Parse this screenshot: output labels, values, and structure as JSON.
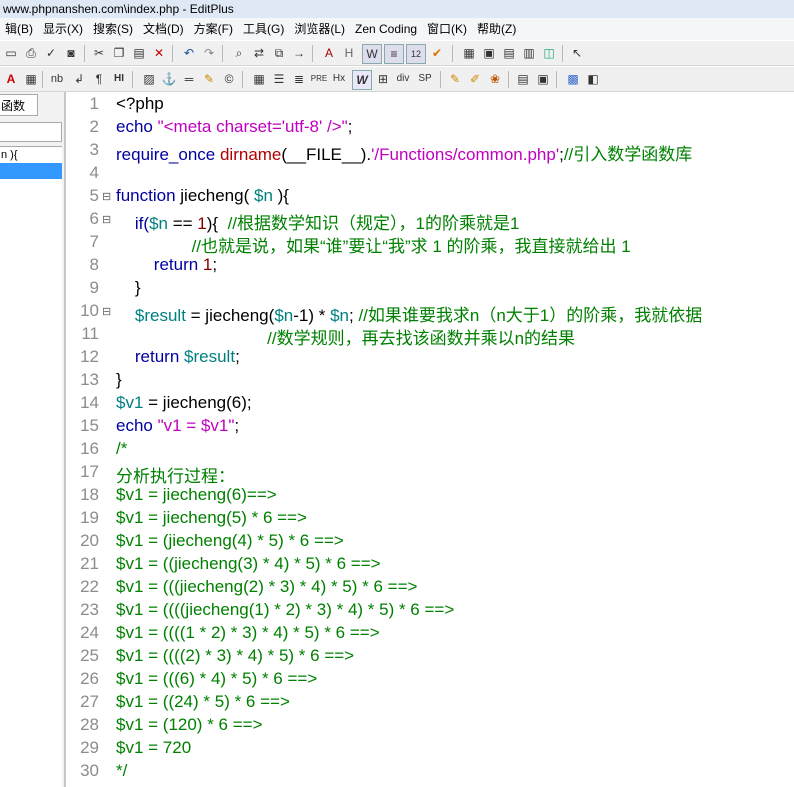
{
  "window": {
    "title": "www.phpnanshen.com\\index.php - EditPlus"
  },
  "menu": [
    "辑(B)",
    "显示(X)",
    "搜索(S)",
    "文档(D)",
    "方案(F)",
    "工具(G)",
    "浏览器(L)",
    "Zen Coding",
    "窗口(K)",
    "帮助(Z)"
  ],
  "toolbar2_labels": {
    "a": "A",
    "nb": "nb",
    "hi": "HI",
    "hx": "Hx",
    "pre": "PRE",
    "w": "W",
    "div": "div",
    "sp": "SP"
  },
  "sidebar": {
    "tab_label": "函数",
    "items": [
      "n ){"
    ]
  },
  "editor": {
    "lines": [
      {
        "n": "1",
        "fold": "",
        "segments": [
          {
            "t": "<?php",
            "c": "#000000"
          }
        ]
      },
      {
        "n": "2",
        "fold": "",
        "segments": [
          {
            "t": "echo ",
            "c": "#0000a0"
          },
          {
            "t": "\"<meta charset='utf-8' />\"",
            "c": "#c000c0"
          },
          {
            "t": ";",
            "c": "#000000"
          }
        ]
      },
      {
        "n": "3",
        "fold": "",
        "segments": [
          {
            "t": "require_once ",
            "c": "#0000a0"
          },
          {
            "t": "dirname",
            "c": "#b00000"
          },
          {
            "t": "(__FILE__).",
            "c": "#000000"
          },
          {
            "t": "'/Functions/common.php'",
            "c": "#c000c0"
          },
          {
            "t": ";",
            "c": "#000000"
          },
          {
            "t": "//引入数学函数库",
            "c": "#008000"
          }
        ]
      },
      {
        "n": "4",
        "fold": "",
        "segments": []
      },
      {
        "n": "5",
        "fold": "⊟",
        "segments": [
          {
            "t": "function ",
            "c": "#0000a0"
          },
          {
            "t": "jiecheng( ",
            "c": "#000000"
          },
          {
            "t": "$n",
            "c": "#008080"
          },
          {
            "t": " ){",
            "c": "#000000"
          }
        ]
      },
      {
        "n": "6",
        "fold": "⊟",
        "segments": [
          {
            "t": "    if(",
            "c": "#0000a0"
          },
          {
            "t": "$n",
            "c": "#008080"
          },
          {
            "t": " == ",
            "c": "#000000"
          },
          {
            "t": "1",
            "c": "#800000"
          },
          {
            "t": "){  ",
            "c": "#000000"
          },
          {
            "t": "//根据数学知识（规定），1的阶乘就是1",
            "c": "#008000"
          }
        ]
      },
      {
        "n": "7",
        "fold": "",
        "segments": [
          {
            "t": "                //也就是说，如果“谁”要让“我”求 1 的阶乘，我直接就给出 1",
            "c": "#008000"
          }
        ]
      },
      {
        "n": "8",
        "fold": "",
        "segments": [
          {
            "t": "        return ",
            "c": "#0000a0"
          },
          {
            "t": "1",
            "c": "#800000"
          },
          {
            "t": ";",
            "c": "#000000"
          }
        ]
      },
      {
        "n": "9",
        "fold": "",
        "segments": [
          {
            "t": "    }",
            "c": "#000000"
          }
        ]
      },
      {
        "n": "10",
        "fold": "⊟",
        "segments": [
          {
            "t": "    ",
            "c": "#000000"
          },
          {
            "t": "$result",
            "c": "#008080"
          },
          {
            "t": " = jiecheng(",
            "c": "#000000"
          },
          {
            "t": "$n",
            "c": "#008080"
          },
          {
            "t": "-1) * ",
            "c": "#000000"
          },
          {
            "t": "$n",
            "c": "#008080"
          },
          {
            "t": "; ",
            "c": "#000000"
          },
          {
            "t": "//如果谁要我求n（n大于1）的阶乘，我就依据",
            "c": "#008000"
          }
        ]
      },
      {
        "n": "11",
        "fold": "",
        "segments": [
          {
            "t": "                                //数学规则，再去找该函数并乘以n的结果",
            "c": "#008000"
          }
        ]
      },
      {
        "n": "12",
        "fold": "",
        "segments": [
          {
            "t": "    return ",
            "c": "#0000a0"
          },
          {
            "t": "$result",
            "c": "#008080"
          },
          {
            "t": ";",
            "c": "#000000"
          }
        ]
      },
      {
        "n": "13",
        "fold": "",
        "segments": [
          {
            "t": "}",
            "c": "#000000"
          }
        ]
      },
      {
        "n": "14",
        "fold": "",
        "segments": [
          {
            "t": "$v1",
            "c": "#008080"
          },
          {
            "t": " = jiecheng(6);",
            "c": "#000000"
          }
        ]
      },
      {
        "n": "15",
        "fold": "",
        "segments": [
          {
            "t": "echo ",
            "c": "#0000a0"
          },
          {
            "t": "\"v1 = $v1\"",
            "c": "#c000c0"
          },
          {
            "t": ";",
            "c": "#000000"
          }
        ]
      },
      {
        "n": "16",
        "fold": "",
        "segments": [
          {
            "t": "/*",
            "c": "#008000"
          }
        ]
      },
      {
        "n": "17",
        "fold": "",
        "segments": [
          {
            "t": "分析执行过程：",
            "c": "#008000"
          }
        ]
      },
      {
        "n": "18",
        "fold": "",
        "segments": [
          {
            "t": "$v1 = jiecheng(6)==>",
            "c": "#008000"
          }
        ]
      },
      {
        "n": "19",
        "fold": "",
        "segments": [
          {
            "t": "$v1 = jiecheng(5) * 6 ==>",
            "c": "#008000"
          }
        ]
      },
      {
        "n": "20",
        "fold": "",
        "segments": [
          {
            "t": "$v1 = (jiecheng(4) * 5) * 6 ==>",
            "c": "#008000"
          }
        ]
      },
      {
        "n": "21",
        "fold": "",
        "segments": [
          {
            "t": "$v1 = ((jiecheng(3) * 4) * 5) * 6 ==>",
            "c": "#008000"
          }
        ]
      },
      {
        "n": "22",
        "fold": "",
        "segments": [
          {
            "t": "$v1 = (((jiecheng(2) * 3) * 4) * 5) * 6 ==>",
            "c": "#008000"
          }
        ]
      },
      {
        "n": "23",
        "fold": "",
        "segments": [
          {
            "t": "$v1 = ((((jiecheng(1) * 2) * 3) * 4) * 5) * 6 ==>",
            "c": "#008000"
          }
        ]
      },
      {
        "n": "24",
        "fold": "",
        "segments": [
          {
            "t": "$v1 = ((((1 * 2) * 3) * 4) * 5) * 6 ==>",
            "c": "#008000"
          }
        ]
      },
      {
        "n": "25",
        "fold": "",
        "segments": [
          {
            "t": "$v1 = ((((2) * 3) * 4) * 5) * 6 ==>",
            "c": "#008000"
          }
        ]
      },
      {
        "n": "26",
        "fold": "",
        "segments": [
          {
            "t": "$v1 = (((6) * 4) * 5) * 6 ==>",
            "c": "#008000"
          }
        ]
      },
      {
        "n": "27",
        "fold": "",
        "segments": [
          {
            "t": "$v1 = ((24) * 5) * 6 ==>",
            "c": "#008000"
          }
        ]
      },
      {
        "n": "28",
        "fold": "",
        "segments": [
          {
            "t": "$v1 = (120) * 6 ==>",
            "c": "#008000"
          }
        ]
      },
      {
        "n": "29",
        "fold": "",
        "segments": [
          {
            "t": "$v1 = 720",
            "c": "#008000"
          }
        ]
      },
      {
        "n": "30",
        "fold": "",
        "segments": [
          {
            "t": "*/",
            "c": "#008000"
          }
        ]
      }
    ]
  }
}
